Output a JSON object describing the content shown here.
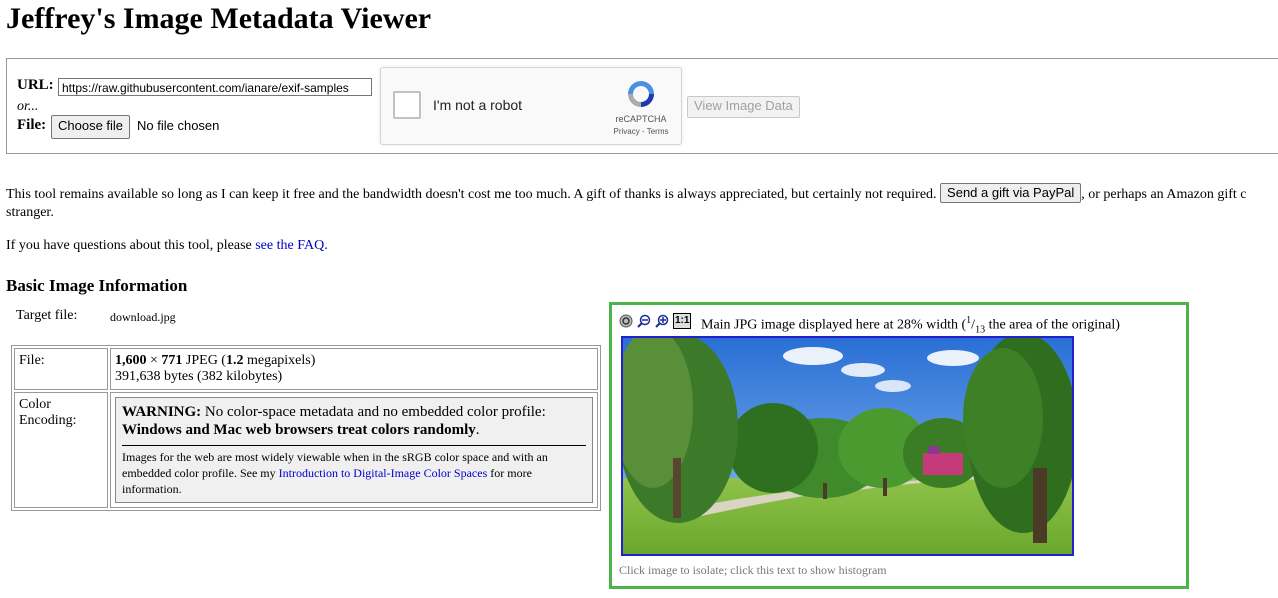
{
  "title": "Jeffrey's Image Metadata Viewer",
  "form": {
    "url_label": "URL:",
    "url_value": "https://raw.githubusercontent.com/ianare/exif-samples",
    "or_text": "or...",
    "file_label": "File:",
    "choose_file_label": "Choose file",
    "no_file_text": "No file chosen",
    "recaptcha": {
      "label": "I'm not a robot",
      "brand": "reCAPTCHA",
      "links": "Privacy - Terms"
    },
    "view_button_label": "View Image Data"
  },
  "intro": {
    "line1_a": "This tool remains available so long as I can keep it free and the bandwidth doesn't cost me too much. A gift of thanks is always appreciated, but certainly not required.",
    "paypal_button": "Send a gift via PayPal",
    "line1_b": ", or perhaps an Amazon gift c",
    "line2": "stranger.",
    "faq_prefix": "If you have questions about this tool, please ",
    "faq_link": "see the FAQ",
    "faq_suffix": "."
  },
  "basic_info": {
    "heading": "Basic Image Information",
    "target_label": "Target file:",
    "target_value": "download.jpg",
    "file_label": "File:",
    "dims_w": "1,600",
    "dims_times": " × ",
    "dims_h": "771",
    "dims_fmt": " JPEG (",
    "megapixels": "1.2",
    "mp_suffix": " megapixels)",
    "bytes_line": "391,638 bytes (382 kilobytes)",
    "color_label_1": "Color",
    "color_label_2": "Encoding:",
    "warning_title": "WARNING:",
    "warning_text": " No color-space metadata and no embedded color profile:",
    "warning_bold": "Windows and Mac web browsers treat colors randomly",
    "warning_end": ".",
    "info_text": "Images for the web are most widely viewable when in the sRGB color space and with an embedded color profile. See my ",
    "info_link": "Introduction to Digital-Image Color Spaces",
    "info_end": " for more information."
  },
  "image_panel": {
    "caption_a": "Main JPG image displayed here at 28% width (",
    "frac_num": "1",
    "frac_sep": "/",
    "frac_den": "13",
    "caption_b": " the area of the original)",
    "one_to_one": "1:1",
    "note": "Click image to isolate; click this text to show histogram"
  },
  "colors": {
    "panel_border": "#4cb54a",
    "link": "#0000cc",
    "image_border": "#2222cc"
  }
}
